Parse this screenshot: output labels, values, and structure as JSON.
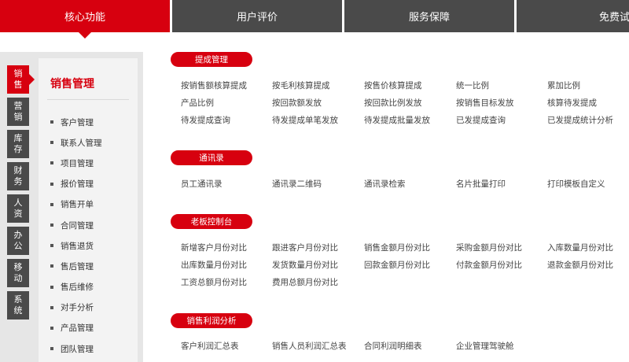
{
  "tabs": [
    {
      "label": "核心功能",
      "active": true
    },
    {
      "label": "用户评价",
      "active": false
    },
    {
      "label": "服务保障",
      "active": false
    },
    {
      "label": "免费试用",
      "active": false
    }
  ],
  "side_tabs": [
    {
      "label": "销售",
      "active": true
    },
    {
      "label": "营销",
      "active": false
    },
    {
      "label": "库存",
      "active": false
    },
    {
      "label": "财务",
      "active": false
    },
    {
      "label": "人资",
      "active": false
    },
    {
      "label": "办公",
      "active": false
    },
    {
      "label": "移动",
      "active": false
    },
    {
      "label": "系统",
      "active": false
    }
  ],
  "section": {
    "title": "销售管理",
    "items": [
      "客户管理",
      "联系人管理",
      "项目管理",
      "报价管理",
      "销售开单",
      "合同管理",
      "销售退货",
      "售后管理",
      "售后维修",
      "对手分析",
      "产品管理",
      "团队管理"
    ]
  },
  "groups": [
    {
      "title": "提成管理",
      "rows": [
        [
          "按销售额核算提成",
          "按毛利核算提成",
          "按售价核算提成",
          "统一比例",
          "累加比例"
        ],
        [
          "产品比例",
          "按回款额发放",
          "按回款比例发放",
          "按销售目标发放",
          "核算待发提成"
        ],
        [
          "待发提成查询",
          "待发提成单笔发放",
          "待发提成批量发放",
          "已发提成查询",
          "已发提成统计分析"
        ]
      ]
    },
    {
      "title": "通讯录",
      "rows": [
        [
          "员工通讯录",
          "通讯录二维码",
          "通讯录检索",
          "名片批量打印",
          "打印模板自定义"
        ]
      ]
    },
    {
      "title": "老板控制台",
      "rows": [
        [
          "新增客户月份对比",
          "跟进客户月份对比",
          "销售金额月份对比",
          "采购金额月份对比",
          "入库数量月份对比"
        ],
        [
          "出库数量月份对比",
          "发货数量月份对比",
          "回款金额月份对比",
          "付款金额月份对比",
          "退款金额月份对比"
        ],
        [
          "工资总额月份对比",
          "费用总额月份对比"
        ]
      ]
    },
    {
      "title": "销售利润分析",
      "rows": [
        [
          "客户利润汇总表",
          "销售人员利润汇总表",
          "合同利润明细表",
          "企业管理驾驶舱"
        ]
      ]
    }
  ],
  "colors": {
    "accent": "#d7000f",
    "tab_bg": "#4a4a4a"
  }
}
